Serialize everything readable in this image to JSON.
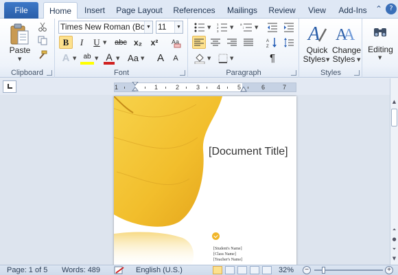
{
  "tabs": {
    "file": "File",
    "items": [
      "Home",
      "Insert",
      "Page Layout",
      "References",
      "Mailings",
      "Review",
      "View",
      "Add-Ins"
    ],
    "active": "Home"
  },
  "clipboard": {
    "label": "Clipboard",
    "paste": "Paste"
  },
  "font": {
    "label": "Font",
    "family": "Times New Roman (Body",
    "size": "11",
    "bold": "B",
    "italic": "I",
    "underline": "U",
    "strike": "abc",
    "subscript": "x₂",
    "superscript": "x²",
    "grow": "A",
    "shrink": "A",
    "change_case": "Aa",
    "font_color_letter": "A",
    "highlight_letter": "ab",
    "effects_letter": "A"
  },
  "paragraph": {
    "label": "Paragraph",
    "pilcrow": "¶"
  },
  "styles": {
    "label": "Styles",
    "quick_styles": [
      "Quick",
      "Styles"
    ],
    "change_styles": [
      "Change",
      "Styles"
    ]
  },
  "editing": {
    "label": "Editing"
  },
  "ruler": {
    "numbers": [
      "1",
      "1",
      "2",
      "3",
      "4",
      "5",
      "6",
      "7"
    ]
  },
  "document": {
    "title": "[Document Title]",
    "info_lines": [
      "[Student's Name]",
      "[Class Name]",
      "[Teacher's Name]"
    ]
  },
  "statusbar": {
    "page": "Page: 1 of 5",
    "words": "Words: 489",
    "language": "English (U.S.)",
    "zoom": "32%",
    "zoom_fraction": 0.12
  },
  "colors": {
    "accent": "#2a5ea8",
    "selected": "#fde18d",
    "butterfly": "#f2be2c"
  }
}
